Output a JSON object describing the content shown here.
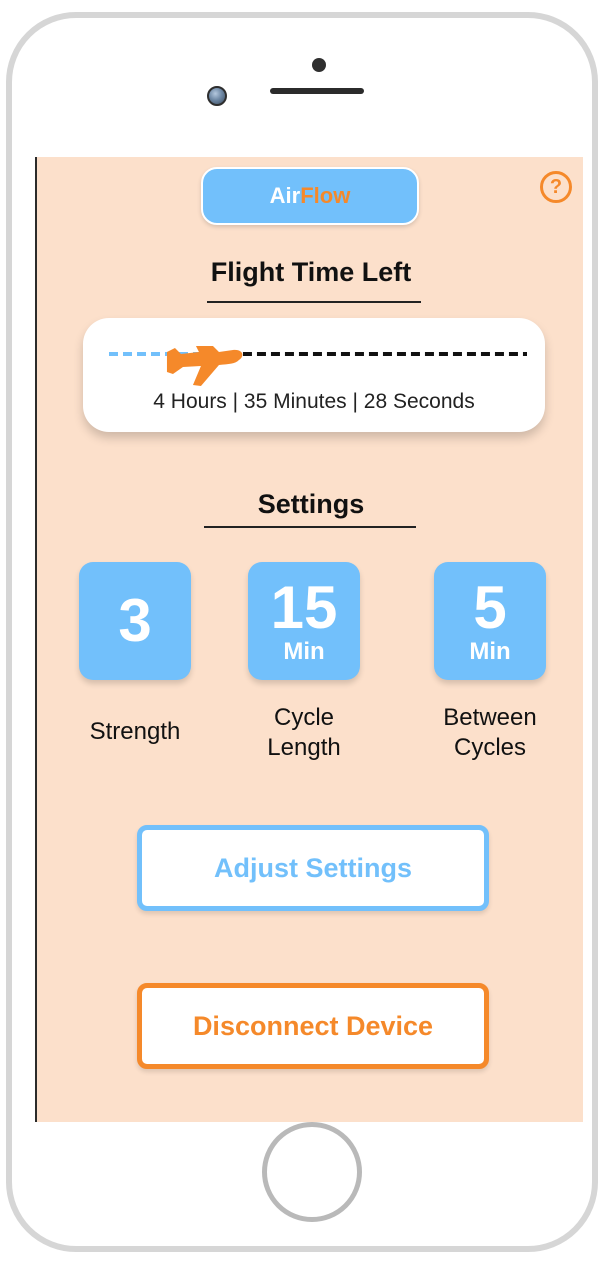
{
  "app": {
    "name_part1": "Air",
    "name_part2": "Flow",
    "help_glyph": "?"
  },
  "flight": {
    "title": "Flight Time Left",
    "remaining_text": "4 Hours | 35 Minutes | 28 Seconds",
    "progress_fraction": 0.22
  },
  "settings": {
    "title": "Settings",
    "items": [
      {
        "value": "3",
        "unit": "",
        "label_line1": "Strength",
        "label_line2": ""
      },
      {
        "value": "15",
        "unit": "Min",
        "label_line1": "Cycle",
        "label_line2": "Length"
      },
      {
        "value": "5",
        "unit": "Min",
        "label_line1": "Between",
        "label_line2": "Cycles"
      }
    ]
  },
  "buttons": {
    "adjust_label": "Adjust Settings",
    "disconnect_label": "Disconnect Device"
  },
  "colors": {
    "screen_bg": "#fce0cb",
    "accent_blue": "#72c0fb",
    "accent_orange": "#f5892a"
  },
  "icons": {
    "help": "help-icon",
    "plane": "airplane-icon"
  }
}
